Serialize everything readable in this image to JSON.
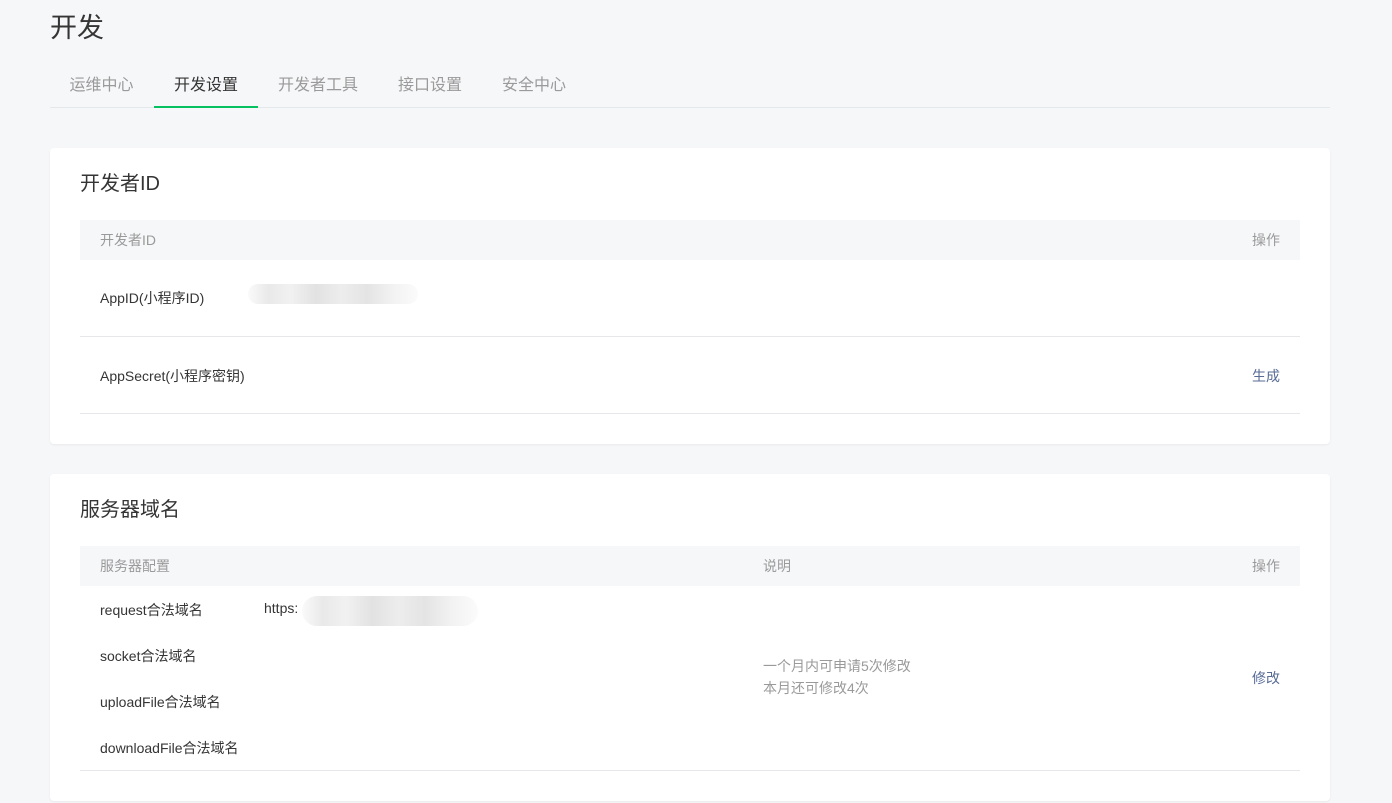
{
  "header": {
    "title": "开发"
  },
  "tabs": [
    {
      "label": "运维中心",
      "active": false
    },
    {
      "label": "开发设置",
      "active": true
    },
    {
      "label": "开发者工具",
      "active": false
    },
    {
      "label": "接口设置",
      "active": false
    },
    {
      "label": "安全中心",
      "active": false
    }
  ],
  "developer_id": {
    "title": "开发者ID",
    "columns": {
      "name": "开发者ID",
      "action": "操作"
    },
    "rows": [
      {
        "name": "AppID(小程序ID)",
        "value": "",
        "action": ""
      },
      {
        "name": "AppSecret(小程序密钥)",
        "value": "",
        "action": "生成"
      }
    ]
  },
  "server_domain": {
    "title": "服务器域名",
    "columns": {
      "config": "服务器配置",
      "desc": "说明",
      "action": "操作"
    },
    "rows": [
      {
        "name": "request合法域名",
        "value": "https:"
      },
      {
        "name": "socket合法域名",
        "value": ""
      },
      {
        "name": "uploadFile合法域名",
        "value": ""
      },
      {
        "name": "downloadFile合法域名",
        "value": ""
      }
    ],
    "note_line1": "一个月内可申请5次修改",
    "note_line2": "本月还可修改4次",
    "action": "修改"
  },
  "colors": {
    "accent": "#07c160",
    "link": "#576b95",
    "background": "#f6f7f9"
  }
}
